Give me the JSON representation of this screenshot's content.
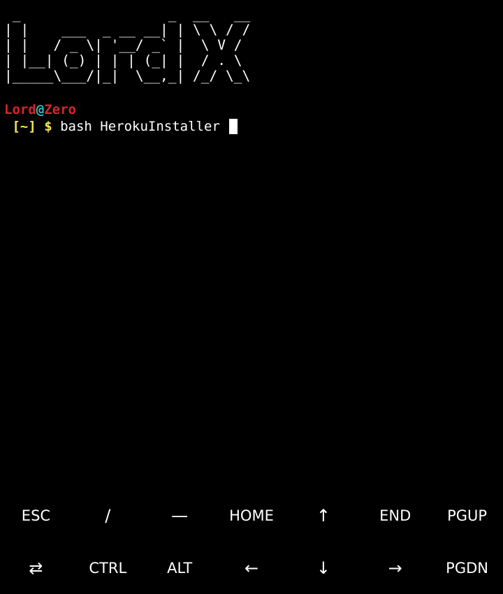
{
  "banner": {
    "lines": [
      " _                  _  __   __",
      "| |    ___  _ __ __| | \\ \\ / /",
      "| |   / _ \\| '__/ _` |  \\ V / ",
      "| |__| (_) | | | (_| |  / . \\ ",
      "|_____\\___/|_|  \\__,_| /_/ \\_\\"
    ]
  },
  "prompt": {
    "user": "Lord",
    "at": "@",
    "host": "Zero",
    "dir": " [~]",
    "symbol": " $",
    "command": " bash HerokuInstaller "
  },
  "extra_keys": {
    "row1": [
      {
        "label": "ESC",
        "name": "esc-key"
      },
      {
        "label": "/",
        "name": "slash-key"
      },
      {
        "label": "—",
        "name": "dash-key"
      },
      {
        "label": "HOME",
        "name": "home-key"
      },
      {
        "label": "↑",
        "name": "arrow-up-key"
      },
      {
        "label": "END",
        "name": "end-key"
      },
      {
        "label": "PGUP",
        "name": "pgup-key"
      }
    ],
    "row2": [
      {
        "label": "⇄",
        "name": "tab-key"
      },
      {
        "label": "CTRL",
        "name": "ctrl-key"
      },
      {
        "label": "ALT",
        "name": "alt-key"
      },
      {
        "label": "←",
        "name": "arrow-left-key"
      },
      {
        "label": "↓",
        "name": "arrow-down-key"
      },
      {
        "label": "→",
        "name": "arrow-right-key"
      },
      {
        "label": "PGDN",
        "name": "pgdn-key"
      }
    ]
  },
  "colors": {
    "background": "#000000",
    "user": "#d7262b",
    "at": "#29c5c7",
    "dir": "#f2e85a",
    "text": "#ffffff"
  }
}
